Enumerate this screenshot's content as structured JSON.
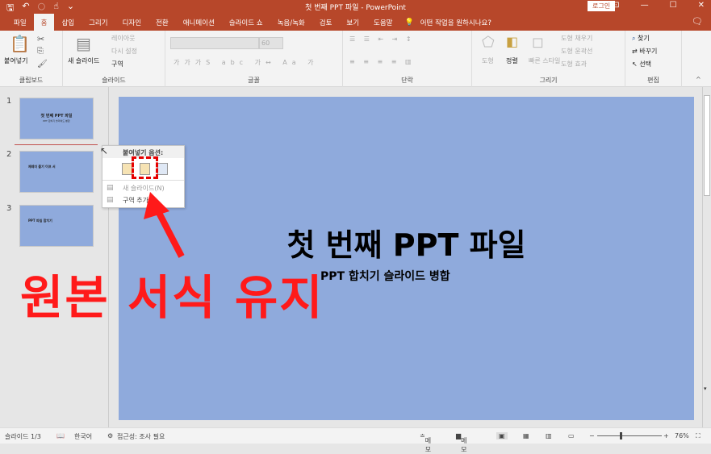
{
  "titlebar": {
    "title": "첫 번째 PPT 파일  -  PowerPoint",
    "login": "로그인",
    "qat": [
      "save-icon",
      "undo-icon",
      "redo-icon",
      "touch-mode-icon",
      "customize-icon"
    ]
  },
  "tabs": [
    "파일",
    "홈",
    "삽입",
    "그리기",
    "디자인",
    "전환",
    "애니메이션",
    "슬라이드 쇼",
    "녹음/녹화",
    "검토",
    "보기",
    "도움말"
  ],
  "active_tab": "홈",
  "tell_me": "어떤 작업을 원하시나요?",
  "ribbon": {
    "clipboard": {
      "paste": "붙여넣기",
      "label": "클립보드"
    },
    "slides": {
      "new_slide": "새 슬라이드",
      "layout": "레이아웃",
      "reset": "다시 설정",
      "section": "구역",
      "label": "슬라이드"
    },
    "font": {
      "size": "60",
      "label": "글꼴"
    },
    "paragraph": {
      "label": "단락"
    },
    "drawing": {
      "shapes": "도형",
      "arrange": "정렬",
      "quick_styles": "빠른 스타일",
      "fill": "도형 채우기",
      "outline": "도형 윤곽선",
      "effects": "도형 효과",
      "label": "그리기"
    },
    "editing": {
      "find": "찾기",
      "replace": "바꾸기",
      "select": "선택",
      "label": "편집"
    }
  },
  "thumbnails": [
    {
      "num": "1",
      "title": "첫 번째 PPT 파일",
      "sub": "PPT 합치기 슬라이드 병합"
    },
    {
      "num": "2",
      "title": "제레미 블기 이프 서"
    },
    {
      "num": "3",
      "title": "PPT 파일 합치기"
    }
  ],
  "context_menu": {
    "header": "붙여넣기 옵션:",
    "items": [
      "새 슬라이드(N)",
      "구역 추가"
    ],
    "paste_options": [
      "use-destination-theme-icon",
      "keep-source-formatting-icon",
      "picture-icon"
    ]
  },
  "slide": {
    "title": "첫 번째 PPT 파일",
    "subtitle": "PPT 합치기 슬라이드 병합"
  },
  "annotation": {
    "text": "원본 서식 유지",
    "color": "#ff1a1a"
  },
  "status": {
    "slide": "슬라이드 1/3",
    "language": "한국어",
    "accessibility": "접근성: 조사 필요",
    "notes": "메모",
    "comments": "메모",
    "zoom": "76%"
  },
  "colors": {
    "accent": "#b7472a",
    "slide_bg": "#8faadc"
  }
}
